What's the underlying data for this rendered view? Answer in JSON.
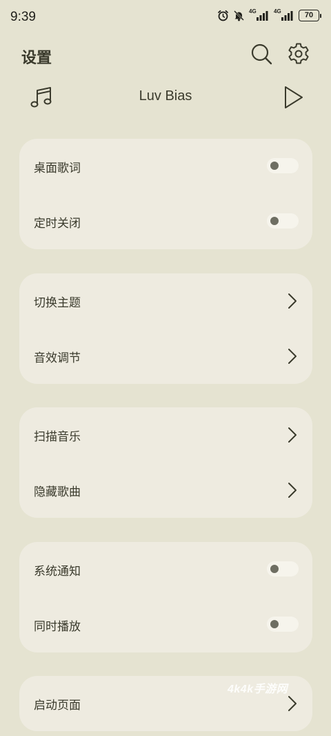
{
  "status_bar": {
    "time": "9:39",
    "battery": "70",
    "net_label_1": "4G",
    "net_label_2": "4G",
    "icons": [
      "alarm-icon",
      "bell-off-icon",
      "signal-icon",
      "signal-icon",
      "battery-icon"
    ]
  },
  "header": {
    "title": "设置",
    "icons": [
      "search-icon",
      "gear-icon"
    ]
  },
  "now_playing": {
    "song": "Luv Bias",
    "icons": [
      "music-note-icon",
      "play-icon"
    ]
  },
  "groups": [
    {
      "items": [
        {
          "label": "桌面歌词",
          "control": "toggle",
          "on": false
        },
        {
          "label": "定时关闭",
          "control": "toggle",
          "on": false
        }
      ]
    },
    {
      "items": [
        {
          "label": "切换主题",
          "control": "chevron"
        },
        {
          "label": "音效调节",
          "control": "chevron"
        }
      ]
    },
    {
      "items": [
        {
          "label": "扫描音乐",
          "control": "chevron"
        },
        {
          "label": "隐藏歌曲",
          "control": "chevron"
        }
      ]
    },
    {
      "items": [
        {
          "label": "系统通知",
          "control": "toggle",
          "on": false
        },
        {
          "label": "同时播放",
          "control": "toggle",
          "on": false
        }
      ]
    },
    {
      "items": [
        {
          "label": "启动页面",
          "control": "chevron"
        }
      ]
    }
  ],
  "watermark": "4k4k手游网",
  "colors": {
    "background": "#e5e3d1",
    "card": "#eeebe0",
    "text": "#3a3a2c",
    "toggle_track": "#f6f4ec",
    "toggle_knob": "#6e6e62"
  }
}
